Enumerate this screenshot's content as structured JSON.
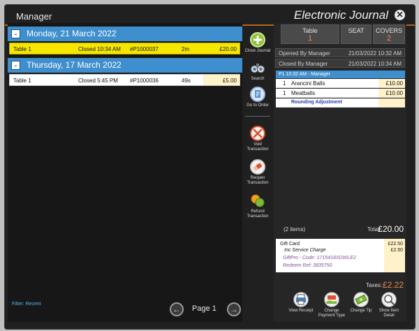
{
  "window": {
    "title_left": "Manager",
    "title_right": "Electronic Journal",
    "close_glyph": "✕"
  },
  "days": [
    {
      "label": "Monday, 21 March 2022",
      "toggle": "-",
      "transactions": [
        {
          "table": "Table 1",
          "status": "Closed 10:34 AM",
          "ref": "#P1000037",
          "duration": "2m",
          "amount": "£20.00",
          "selected": true
        }
      ]
    },
    {
      "label": "Thursday, 17 March 2022",
      "toggle": "-",
      "transactions": [
        {
          "table": "Table 1",
          "status": "Closed   5:45 PM",
          "ref": "#P1000036",
          "duration": "49s",
          "amount": "£5.00",
          "selected": false
        }
      ]
    }
  ],
  "filter_label": "Filter: Recent",
  "pager": {
    "label": "Page 1",
    "prev_glyph": "←",
    "next_glyph": "→"
  },
  "toolbar": [
    {
      "name": "close-journal",
      "label": "Close Journal",
      "icon": "plus-circle-icon",
      "color": "#8fc23f"
    },
    {
      "name": "search",
      "label": "Search",
      "icon": "binoculars-icon",
      "color": "#d9d9d9"
    },
    {
      "name": "go-to-order",
      "label": "Go to Order",
      "icon": "document-icon",
      "color": "#4a8fd0"
    },
    {
      "name": "void-transaction",
      "label": "Void Transaction",
      "icon": "x-circle-icon",
      "color": "#e0502a"
    },
    {
      "name": "reopen-transaction",
      "label": "Reopen Transaction",
      "icon": "eraser-icon",
      "color": "#e0502a"
    },
    {
      "name": "refund-transaction",
      "label": "Refund Transaction",
      "icon": "coins-icon",
      "color": "#f0a020"
    }
  ],
  "summary": {
    "table_label": "Table",
    "table_value": "1",
    "seat_label": "SEAT",
    "covers_label": "COVERS",
    "covers_value": "2",
    "opened_by": "Opened By Manager",
    "opened_at": "21/03/2022 10:32 AM",
    "closed_by": "Closed By Manager",
    "closed_at": "21/03/2022 10:34 AM"
  },
  "order": {
    "header": "P1 10:32 AM - Manager",
    "items": [
      {
        "qty": "1",
        "name": "Arancini Balls",
        "amount": "£10.00"
      },
      {
        "qty": "1",
        "name": "Meatballs",
        "amount": "£10.00"
      }
    ],
    "adjustment": "Rounding Adjustment"
  },
  "totals": {
    "items_count": "(2 items)",
    "total_label": "Total:",
    "total_value": "£20.00"
  },
  "tender": {
    "method": "Gift Card",
    "method_amount": "£22.50",
    "service_label": "Inc Service Charge",
    "service_amount": "£2.50",
    "code_line": "GiftPro - Code: 1715418XDWLE2",
    "redeem_line": "Redeem Ref: 3835750"
  },
  "taxes": {
    "label": "Taxes:",
    "value": "£2.22"
  },
  "actions": [
    {
      "name": "view-receipt",
      "label": "View Receipt",
      "icon": "printer-icon"
    },
    {
      "name": "change-payment-type",
      "label": "Change Payment Type",
      "icon": "payment-hand-icon"
    },
    {
      "name": "change-tip",
      "label": "Change Tip",
      "icon": "cash-icon"
    },
    {
      "name": "show-item-detail",
      "label": "Show Item Detail",
      "icon": "magnifier-icon"
    }
  ],
  "colors": {
    "accent_blue": "#3f8fce",
    "selected_yellow": "#f6e600",
    "amount_orange": "#e88a50"
  }
}
